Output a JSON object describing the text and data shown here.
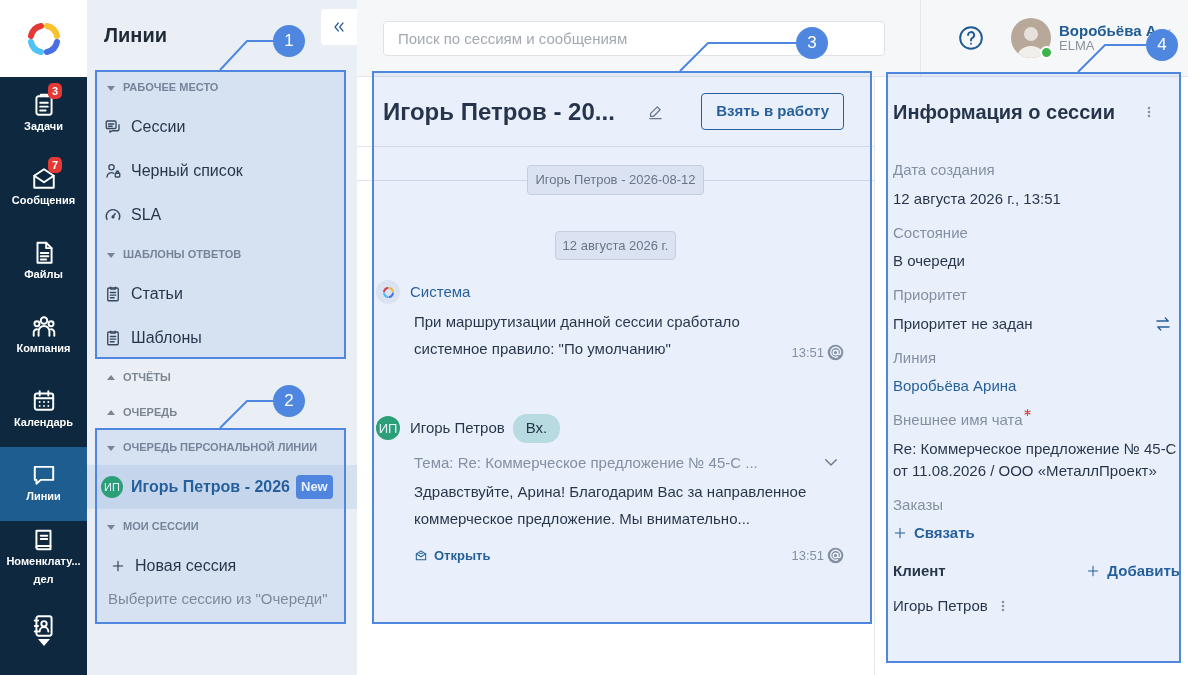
{
  "rail": {
    "items": [
      {
        "label": "Задачи",
        "badge": "3",
        "selected": false
      },
      {
        "label": "Сообщения",
        "badge": "7",
        "selected": false
      },
      {
        "label": "Файлы",
        "selected": false
      },
      {
        "label": "Компания",
        "selected": false
      },
      {
        "label": "Календарь",
        "selected": false
      },
      {
        "label": "Линии",
        "selected": true
      },
      {
        "label": "Номенклату... дел",
        "selected": false
      },
      {
        "selected": false
      }
    ]
  },
  "sidebar": {
    "title": "Линии",
    "sections": [
      {
        "title": "РАБОЧЕЕ МЕСТО",
        "expanded": true,
        "items": [
          {
            "label": "Сессии"
          },
          {
            "label": "Черный список"
          },
          {
            "label": "SLA"
          }
        ]
      },
      {
        "title": "ШАБЛОНЫ ОТВЕТОВ",
        "expanded": true,
        "items": [
          {
            "label": "Статьи"
          },
          {
            "label": "Шаблоны"
          }
        ]
      },
      {
        "title": "ОТЧЁТЫ",
        "expanded": false
      },
      {
        "title": "ОЧЕРЕДЬ",
        "expanded": false
      },
      {
        "title": "ОЧЕРЕДЬ ПЕРСОНАЛЬНОЙ ЛИНИИ",
        "expanded": true,
        "sessions": [
          {
            "initials": "ИП",
            "title": "Игорь Петров - 2026",
            "badge": "New",
            "selected": true
          }
        ]
      },
      {
        "title": "МОИ СЕССИИ",
        "expanded": true,
        "actions": [
          {
            "label": "Новая сессия"
          }
        ],
        "hint": "Выберите сессию из \"Очереди\""
      }
    ]
  },
  "topbar": {
    "search": {
      "placeholder": "Поиск по сессиям и сообщениям"
    },
    "user": {
      "name": "Воробьёва А",
      "org": "ELMA",
      "online": true
    }
  },
  "chat": {
    "title": "Игорь Петров - 20...",
    "action": "Взять в работу",
    "session_chip": "Игорь Петров - 2026-08-12",
    "date_chip": "12 августа 2026 г.",
    "messages": [
      {
        "kind": "system",
        "author": "Система",
        "text": "При маршрутизации данной сессии сработало системное правило: \"По умолчанию\"",
        "time": "13:51"
      },
      {
        "kind": "incoming",
        "initials": "ИП",
        "author": "Игорь Петров",
        "tag": "Вх.",
        "subject": "Тема: Re: Коммерческое предложение № 45-С ...",
        "text": "Здравствуйте, Арина! Благодарим Вас за направленное коммерческое предложение. Мы внимательно...",
        "link": "Открыть",
        "time": "13:51"
      }
    ]
  },
  "info": {
    "title": "Информация о сессии",
    "fields": [
      {
        "kind": "text",
        "label": "Дата создания",
        "required": false,
        "value": "12 августа 2026 г., 13:51"
      },
      {
        "kind": "text",
        "label": "Состояние",
        "required": false,
        "value": "В очереди"
      },
      {
        "kind": "select",
        "label": "Приоритет",
        "required": false,
        "value": "Приоритет не задан"
      },
      {
        "kind": "link",
        "label": "Линия",
        "required": false,
        "value": "Воробьёва Арина"
      },
      {
        "kind": "text",
        "label": "Внешнее имя чата",
        "required": true,
        "value": "Re: Коммерческое предложение № 45-С от 11.08.2026 / ООО «МеталлПроект»"
      },
      {
        "kind": "action",
        "label": "Заказы",
        "required": false,
        "value": "Связать"
      }
    ],
    "client": {
      "title": "Клиент",
      "action": "Добавить",
      "name": "Игорь Петров"
    }
  },
  "callouts": [
    {
      "number": "1"
    },
    {
      "number": "2"
    },
    {
      "number": "3"
    },
    {
      "number": "4"
    }
  ]
}
